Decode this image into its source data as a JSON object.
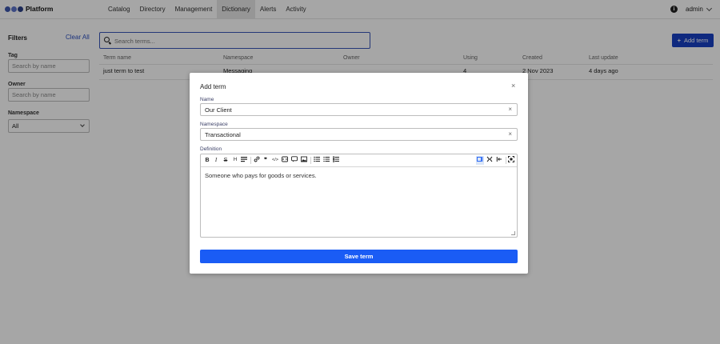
{
  "app": {
    "name": "Platform"
  },
  "nav": {
    "items": [
      {
        "label": "Catalog"
      },
      {
        "label": "Directory"
      },
      {
        "label": "Management"
      },
      {
        "label": "Dictionary"
      },
      {
        "label": "Alerts"
      },
      {
        "label": "Activity"
      }
    ],
    "active": "Dictionary"
  },
  "user": {
    "name": "admin",
    "info_icon": "i"
  },
  "sidebar": {
    "title": "Filters",
    "clear_all": "Clear All",
    "tag_label": "Tag",
    "tag_placeholder": "Search by name",
    "owner_label": "Owner",
    "owner_placeholder": "Search by name",
    "namespace_label": "Namespace",
    "namespace_value": "All"
  },
  "main": {
    "search_placeholder": "Search terms...",
    "add_button": "Add term",
    "add_icon": "+",
    "columns": [
      "Term name",
      "Namespace",
      "Owner",
      "Using",
      "Created",
      "Last update"
    ],
    "rows": [
      {
        "term": "just term to test",
        "namespace": "Messaging",
        "owner": "",
        "using": "4",
        "created": "2 Nov 2023",
        "updated": "4 days ago"
      }
    ]
  },
  "modal": {
    "title": "Add term",
    "close_icon": "×",
    "name_label": "Name",
    "name_value": "Our Client",
    "namespace_label": "Namespace",
    "namespace_value": "Transactional",
    "definition_label": "Definition",
    "definition_value": "Someone who pays for goods or services.",
    "clear_icon": "×",
    "save_button": "Save term"
  },
  "toolbar_icons": {
    "bold": "B",
    "italic": "I",
    "strike": "S",
    "heading": "H",
    "quote": "❞",
    "code": "</>"
  },
  "colors": {
    "primary": "#1740c4",
    "save": "#1a5cf5",
    "overlay": "rgba(0,0,0,0.35)"
  }
}
